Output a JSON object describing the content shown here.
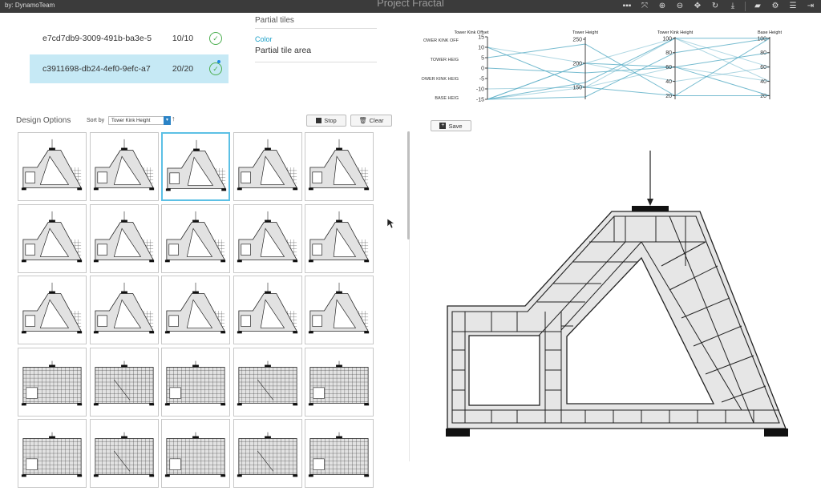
{
  "app": {
    "brand": "by: DynamoTeam",
    "title": "Project Fractal",
    "toolbar_icons": [
      "grid-view-icon",
      "fit-view-icon",
      "zoom-in-icon",
      "zoom-out-icon",
      "pan-icon",
      "rotate-icon",
      "download-icon",
      "comment-icon",
      "settings-icon",
      "list-icon",
      "exit-icon"
    ]
  },
  "runs": [
    {
      "id": "e7cd7db9-3009-491b-ba3e-5",
      "count": "10/10",
      "status": "complete",
      "selected": false
    },
    {
      "id": "c3911698-db24-4ef0-9efc-a7",
      "count": "20/20",
      "status": "complete",
      "selected": true
    }
  ],
  "properties": {
    "partial_label": "Partial tiles",
    "color_label": "Color",
    "color_value": "Partial tile area"
  },
  "parallel_coords": {
    "axes": [
      {
        "name": "Tower Kink Offset",
        "short": "OWER KINK OFF",
        "ticks": [
          "15",
          "10",
          "5",
          "0",
          "-5",
          "-10",
          "-15"
        ],
        "range": [
          -15,
          15
        ]
      },
      {
        "name": "Tower Height",
        "short": "TOWER HEIG",
        "ticks": [
          "250",
          "200",
          "150"
        ],
        "range": [
          125,
          255
        ]
      },
      {
        "name": "Tower Kink Height",
        "short": "OWER KINK HEIG",
        "ticks": [
          "100",
          "80",
          "60",
          "40",
          "20"
        ],
        "range": [
          15,
          102
        ]
      },
      {
        "name": "Base Height",
        "short": "BASE HEIG",
        "ticks": [
          "100",
          "80",
          "60",
          "40",
          "20"
        ],
        "range": [
          15,
          102
        ]
      }
    ],
    "lines": [
      [
        10,
        200,
        100,
        60
      ],
      [
        10,
        150,
        20,
        100
      ],
      [
        -15,
        200,
        60,
        20
      ],
      [
        -15,
        150,
        100,
        40
      ],
      [
        -15,
        130,
        80,
        100
      ],
      [
        0,
        180,
        60,
        80
      ],
      [
        -15,
        200,
        40,
        60
      ],
      [
        5,
        240,
        20,
        20
      ],
      [
        -15,
        160,
        100,
        100
      ],
      [
        -10,
        150,
        60,
        40
      ]
    ],
    "line_color": "#5fb0c8"
  },
  "design_options": {
    "title": "Design Options",
    "sort_label": "Sort by",
    "sort_value": "Tower Kink Height",
    "sort_direction": "↑",
    "stop_label": "Stop",
    "clear_label": "Clear",
    "selected_index": 2,
    "rows": 5,
    "cols": 5
  },
  "viewer": {
    "save_label": "Save"
  },
  "colors": {
    "accent": "#1aa0c8",
    "selected_row": "#c6e9f5",
    "check": "#4caf50",
    "tile_fill": "#e6e6e6"
  }
}
